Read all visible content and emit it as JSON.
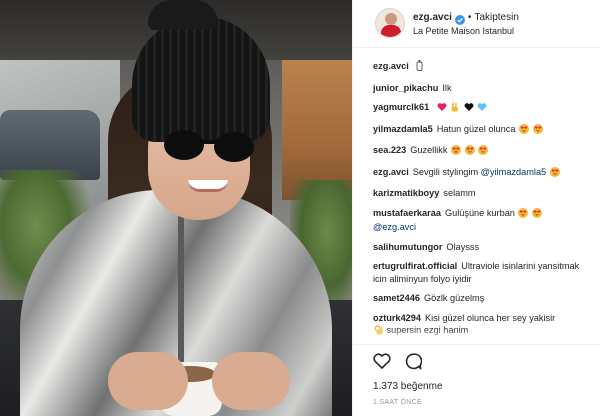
{
  "post": {
    "username": "ezg.avci",
    "follow_label": "Takiptesin",
    "separator": "•",
    "location": "La Petite Maison Istanbul",
    "comments": [
      {
        "user": "ezg.avci",
        "text": "",
        "emoji": [
          "bottle"
        ]
      },
      {
        "user": "junior_pikachu",
        "text": "Ilk",
        "emoji": []
      },
      {
        "user": "yagmurclk61",
        "text": "",
        "emoji": [
          "red-heart",
          "victory-hand",
          "black-heart",
          "blue-heart"
        ]
      },
      {
        "user": "yilmazdamla5",
        "text": "Hatun güzel olunca",
        "emoji": [
          "heart-eyes",
          "heart-eyes"
        ]
      },
      {
        "user": "sea.223",
        "text": "Guzellikk",
        "emoji": [
          "heart-eyes",
          "heart-eyes",
          "heart-eyes"
        ]
      },
      {
        "user": "ezg.avci",
        "text": "Sevgili stylingim",
        "mention": "@yilmazdamla5",
        "emoji": [
          "heart-eyes"
        ]
      },
      {
        "user": "karizmatikboyy",
        "text": "selamm",
        "emoji": []
      },
      {
        "user": "mustafaerkaraa",
        "text": "Gulüşüne kurban",
        "mention_line": "@ezg.avci",
        "emoji": [
          "heart-eyes",
          "heart-eyes"
        ]
      },
      {
        "user": "salihumutungor",
        "text": "Olaysss",
        "emoji": []
      },
      {
        "user": "ertugrulfirat.official",
        "text": "Ultraviole isinlarini yansitmak icin aliminyun folyo iyidir",
        "emoji": []
      },
      {
        "user": "samet2446",
        "text": "Gözlk güzelmş",
        "emoji": []
      },
      {
        "user": "ozturk4294",
        "text": "Kisi güzel olunca her sey yakisir",
        "text2": "supersin ezgi hanim",
        "emoji": [
          "ok-hand"
        ]
      }
    ],
    "likes_label": "1.373 beğenme",
    "time_label": "1 SAAT ÖNCE"
  },
  "icons": {
    "verified": "verified-badge-icon",
    "like": "heart-outline-icon",
    "comment": "comment-bubble-icon"
  },
  "colors": {
    "text": "#262626",
    "verified": "#3897f0",
    "muted": "#999999",
    "link": "#003569"
  }
}
